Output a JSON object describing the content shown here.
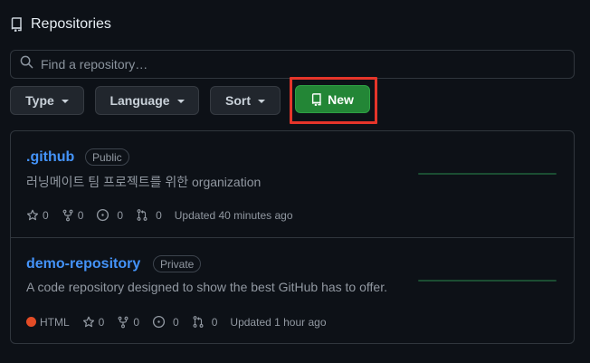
{
  "header": {
    "title": "Repositories",
    "icon": "repo-icon"
  },
  "search": {
    "placeholder": "Find a repository…",
    "value": ""
  },
  "filters": [
    {
      "label": "Type"
    },
    {
      "label": "Language"
    },
    {
      "label": "Sort"
    }
  ],
  "new_button": {
    "label": "New",
    "icon": "repo-icon",
    "color": "#238636"
  },
  "highlight_color": "#e5352a",
  "repos": [
    {
      "name": ".github",
      "visibility": "Public",
      "description": "러닝메이트 팀 프로젝트를 위한 organization",
      "stars": "0",
      "forks": "0",
      "issues": "0",
      "pulls": "0",
      "updated": "Updated 40 minutes ago"
    },
    {
      "name": "demo-repository",
      "visibility": "Private",
      "description": "A code repository designed to show the best GitHub has to offer.",
      "language": "HTML",
      "language_color": "#e34c26",
      "stars": "0",
      "forks": "0",
      "issues": "0",
      "pulls": "0",
      "updated": "Updated 1 hour ago"
    }
  ]
}
